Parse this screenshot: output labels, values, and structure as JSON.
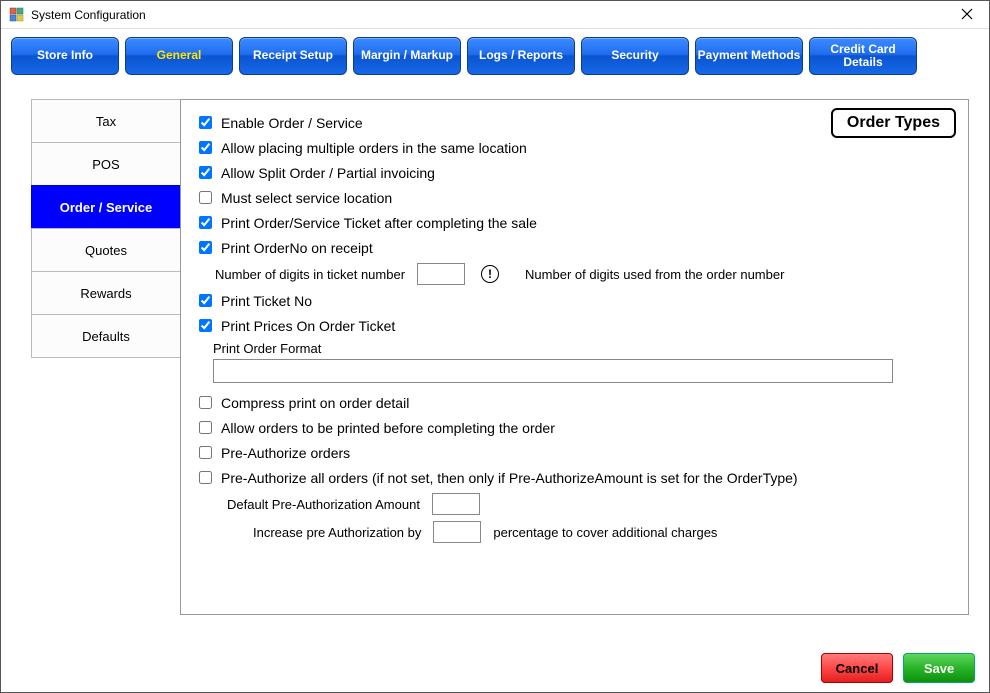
{
  "window": {
    "title": "System Configuration"
  },
  "topnav": {
    "items": [
      {
        "label": "Store Info"
      },
      {
        "label": "General"
      },
      {
        "label": "Receipt Setup"
      },
      {
        "label": "Margin / Markup"
      },
      {
        "label": "Logs / Reports"
      },
      {
        "label": "Security"
      },
      {
        "label": "Payment Methods"
      },
      {
        "label": "Credit Card Details"
      }
    ],
    "active_index": 1
  },
  "sidetabs": {
    "items": [
      {
        "label": "Tax"
      },
      {
        "label": "POS"
      },
      {
        "label": "Order / Service"
      },
      {
        "label": "Quotes"
      },
      {
        "label": "Rewards"
      },
      {
        "label": "Defaults"
      }
    ],
    "active_index": 2
  },
  "panel": {
    "title": "Order Types",
    "enable_order_service": {
      "checked": true,
      "label": "Enable Order / Service"
    },
    "allow_multiple_same_location": {
      "checked": true,
      "label": "Allow placing multiple orders in the same location"
    },
    "allow_split_order": {
      "checked": true,
      "label": "Allow Split Order / Partial invoicing"
    },
    "must_select_location": {
      "checked": false,
      "label": "Must select service location"
    },
    "print_ticket_after_sale": {
      "checked": true,
      "label": "Print Order/Service Ticket after completing the sale"
    },
    "print_orderno_receipt": {
      "checked": true,
      "label": "Print OrderNo on receipt"
    },
    "ticket_digits": {
      "label": "Number of digits in ticket number",
      "value": "",
      "help": "Number of digits used from the order number"
    },
    "print_ticket_no": {
      "checked": true,
      "label": "Print Ticket No"
    },
    "print_prices_on_ticket": {
      "checked": true,
      "label": "Print Prices On Order Ticket"
    },
    "print_order_format": {
      "label": "Print Order Format",
      "value": ""
    },
    "compress_print": {
      "checked": false,
      "label": "Compress print on order detail"
    },
    "allow_print_before_complete": {
      "checked": false,
      "label": "Allow orders to be printed before completing the order"
    },
    "preauth_orders": {
      "checked": false,
      "label": "Pre-Authorize orders"
    },
    "preauth_all_orders": {
      "checked": false,
      "label": "Pre-Authorize all orders (if not set, then only if Pre-AuthorizeAmount is set for the OrderType)"
    },
    "default_preauth": {
      "label": "Default Pre-Authorization Amount",
      "value": ""
    },
    "increase_preauth": {
      "label": "Increase pre Authorization by",
      "value": "",
      "suffix": "percentage to cover additional charges"
    }
  },
  "footer": {
    "cancel": "Cancel",
    "save": "Save"
  }
}
